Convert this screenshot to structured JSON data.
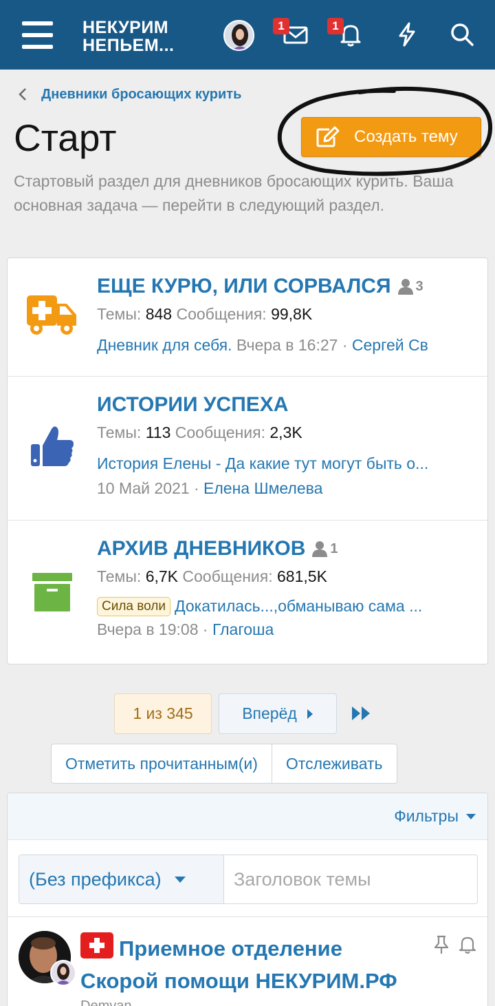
{
  "header": {
    "logo_line1": "НЕКУРИМ",
    "logo_line2": "НЕПЬЕМ...",
    "messages_badge": "1",
    "alerts_badge": "1",
    "icons": [
      "menu-icon",
      "avatar",
      "mail-icon",
      "bell-icon",
      "lightning-icon",
      "search-icon"
    ]
  },
  "breadcrumb": {
    "label": "Дневники бросающих курить"
  },
  "page": {
    "title": "Старт",
    "create_button": "Создать тему",
    "description": "Стартовый раздел для дневников бросающих курить. Ваша основная задача — перейти в следующий раздел."
  },
  "labels": {
    "threads": "Темы:",
    "messages": "Сообщения:"
  },
  "nodes": [
    {
      "title": "ЕЩЕ КУРЮ, ИЛИ СОРВАЛСЯ",
      "users": "3",
      "threads": "848",
      "messages": "99,8K",
      "last_title": "Дневник для себя.",
      "last_time": "Вчера в 16:27",
      "last_user": "Сергей Св",
      "icon": "ambulance-icon",
      "color": "#f39a13"
    },
    {
      "title": "ИСТОРИИ УСПЕХА",
      "threads": "113",
      "messages": "2,3K",
      "last_title": "История Елены - Да какие тут могут быть о...",
      "last_time": "10 Май 2021",
      "last_user": "Елена Шмелева",
      "icon": "thumbs-up-icon",
      "color": "#3b64b5"
    },
    {
      "title": "АРХИВ ДНЕВНИКОВ",
      "users": "1",
      "threads": "6,7K",
      "messages": "681,5K",
      "last_prefix": "Сила воли",
      "last_title": "Докатилась...,обманываю сама ...",
      "last_time": "Вчера в 19:08",
      "last_user": "Глагоша",
      "icon": "archive-box-icon",
      "color": "#6cb544"
    }
  ],
  "pagination": {
    "current": "1 из 345",
    "next": "Вперёд"
  },
  "actions": {
    "mark_read": "Отметить прочитанным(и)",
    "watch": "Отслеживать"
  },
  "threadlist": {
    "filters_label": "Фильтры",
    "prefix_select": "(Без префикса)",
    "title_placeholder": "Заголовок темы",
    "thread": {
      "title": "Приемное отделение Скорой помощи НЕКУРИМ.РФ",
      "author": "Demyan"
    }
  }
}
